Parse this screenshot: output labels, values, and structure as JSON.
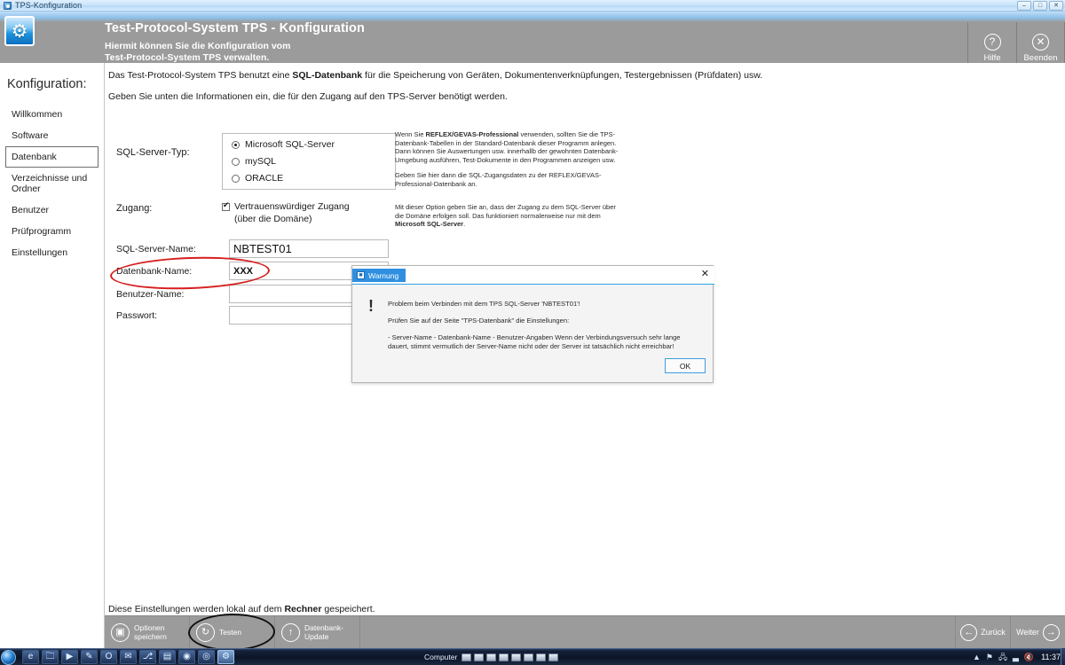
{
  "os": {
    "window_title": "TPS-Konfiguration",
    "title_icon": "app-icon",
    "minimize_label": "–",
    "maximize_label": "□",
    "close_label": "✕"
  },
  "header": {
    "icon": "gear-icon",
    "title": "Test-Protocol-System TPS - Konfiguration",
    "subtitle_line1": "Hiermit können Sie die Konfiguration vom",
    "subtitle_line2": "Test-Protocol-System TPS verwalten.",
    "buttons": [
      {
        "label": "Hilfe",
        "icon": "question-mark-icon",
        "glyph": "?"
      },
      {
        "label": "Beenden",
        "icon": "close-circle-icon",
        "glyph": "✕"
      }
    ]
  },
  "sidebar": {
    "title": "Konfiguration:",
    "items": [
      {
        "label": "Willkommen",
        "active": false
      },
      {
        "label": "Software",
        "active": false
      },
      {
        "label": "Datenbank",
        "active": true
      },
      {
        "label": "Verzeichnisse und Ordner",
        "active": false
      },
      {
        "label": "Benutzer",
        "active": false
      },
      {
        "label": "Prüfprogramm",
        "active": false
      },
      {
        "label": "Einstellungen",
        "active": false
      }
    ]
  },
  "main": {
    "intro_1_a": "Das Test-Protocol-System TPS benutzt eine ",
    "intro_1_b": "SQL-Datenbank",
    "intro_1_c": " für die Speicherung von Geräten, Dokumentenverknüpfungen, Testergebnissen (Prüfdaten) usw.",
    "intro_2": "Geben Sie unten die Informationen ein, die für den Zugang auf den TPS-Server benötigt werden.",
    "server_type_label": "SQL-Server-Typ:",
    "server_type_options": [
      {
        "label": "Microsoft SQL-Server",
        "selected": true
      },
      {
        "label": "mySQL",
        "selected": false
      },
      {
        "label": "ORACLE",
        "selected": false
      }
    ],
    "help_server_type_p1_a": "Wenn Sie ",
    "help_server_type_p1_b": "REFLEX/GEVAS-Professional",
    "help_server_type_p1_c": " verwenden, sollten Sie die TPS-Datenbank-Tabellen in der Standard-Datenbank dieser Programm anlegen. Dann können Sie Auswertungen usw. innerhallb der gewohnten Datenbank-Umgebung ausführen, Test-Dokumente in den Programmen anzeigen usw.",
    "help_server_type_p2": "Geben Sie hier dann die SQL-Zugangsdaten zu der REFLEX/GEVAS-Professional-Datenbank an.",
    "access_label": "Zugang:",
    "access_checkbox_label": "Vertrauenswürdiger Zugang",
    "access_checkbox_sub": "(über die Domäne)",
    "access_checked": true,
    "help_access_a": "Mit dieser Option geben Sie an, dass der Zugang zu dem SQL-Server über die Domäne erfolgen soll. Das funktioniert normalerweise nur mit dem ",
    "help_access_b": "Microsoft SQL-Server",
    "help_access_c": ".",
    "fields": [
      {
        "label": "SQL-Server-Name:",
        "value": "NBTEST01",
        "placeholder": "",
        "big": true
      },
      {
        "label": "Datenbank-Name:",
        "value": "XXX",
        "placeholder": "",
        "big": false
      },
      {
        "label": "Benutzer-Name:",
        "value": "",
        "placeholder": "",
        "big": false
      },
      {
        "label": "Passwort:",
        "value": "",
        "placeholder": "",
        "big": false
      }
    ],
    "footer_note_a": "Diese Einstellungen werden lokal auf dem ",
    "footer_note_b": "Rechner",
    "footer_note_c": " gespeichert."
  },
  "dialog": {
    "tab_label": "Warnung",
    "tab_icon": "warning-badge-icon",
    "close_icon": "close-icon",
    "exclam_icon": "exclamation-icon",
    "line_1": "Problem beim Verbinden mit dem TPS SQL-Server 'NBTEST01'!",
    "line_2": "Prüfen Sie auf der Seite \"TPS-Datenbank\" die Einstellungen:",
    "line_3": "- Server-Name - Datenbank-Name - Benutzer-Angaben  Wenn der Verbindungsversuch sehr lange dauert, stimmt vermutlich der Server-Name nicht oder der Server ist tatsächlich nicht erreichbar!",
    "ok_label": "OK"
  },
  "toolbar": {
    "buttons": [
      {
        "label_1": "Optionen",
        "label_2": "speichern",
        "icon": "save-disk-icon",
        "glyph": "💾"
      },
      {
        "label_1": "Testen",
        "label_2": "",
        "icon": "refresh-icon",
        "glyph": "↻"
      },
      {
        "label_1": "Datenbank-",
        "label_2": "Update",
        "icon": "upload-arrow-icon",
        "glyph": "↑"
      }
    ],
    "nav": [
      {
        "label": "Zurück",
        "icon": "arrow-left-icon",
        "glyph": "←",
        "icon_first": true
      },
      {
        "label": "Weiter",
        "icon": "arrow-right-icon",
        "glyph": "→",
        "icon_first": false
      }
    ]
  },
  "taskbar": {
    "start_icon": "windows-start-orb",
    "apps": [
      {
        "icon": "internet-explorer-icon",
        "glyph": "e",
        "active": false
      },
      {
        "icon": "folder-explorer-icon",
        "glyph": "🗀",
        "active": false
      },
      {
        "icon": "media-player-icon",
        "glyph": "▶",
        "active": false
      },
      {
        "icon": "paint-icon",
        "glyph": "✎",
        "active": false
      },
      {
        "icon": "office-icon",
        "glyph": "O",
        "active": false
      },
      {
        "icon": "outlook-icon",
        "glyph": "✉",
        "active": false
      },
      {
        "icon": "remote-desktop-icon",
        "glyph": "⎇",
        "active": false
      },
      {
        "icon": "window-icon",
        "glyph": "▤",
        "active": false
      },
      {
        "icon": "chrome-icon",
        "glyph": "◉",
        "active": false
      },
      {
        "icon": "camera-icon",
        "glyph": "◎",
        "active": false
      },
      {
        "icon": "tps-config-icon",
        "glyph": "⚙",
        "active": true
      }
    ],
    "group_label": "Computer",
    "drive_count": 8,
    "tray": [
      {
        "icon": "show-hidden-icons-chevron",
        "glyph": "▲"
      },
      {
        "icon": "action-flag-icon",
        "glyph": "⚑"
      },
      {
        "icon": "network-icon",
        "glyph": "🖧"
      },
      {
        "icon": "signal-bars-icon",
        "glyph": "▃"
      },
      {
        "icon": "volume-muted-icon",
        "glyph": "🔇"
      }
    ],
    "clock": "11:37"
  },
  "colors": {
    "header_gray": "#9b9b9b",
    "accent_blue": "#2f8fe0",
    "annotation_red": "#d61f1f",
    "annotation_black": "#111111"
  }
}
